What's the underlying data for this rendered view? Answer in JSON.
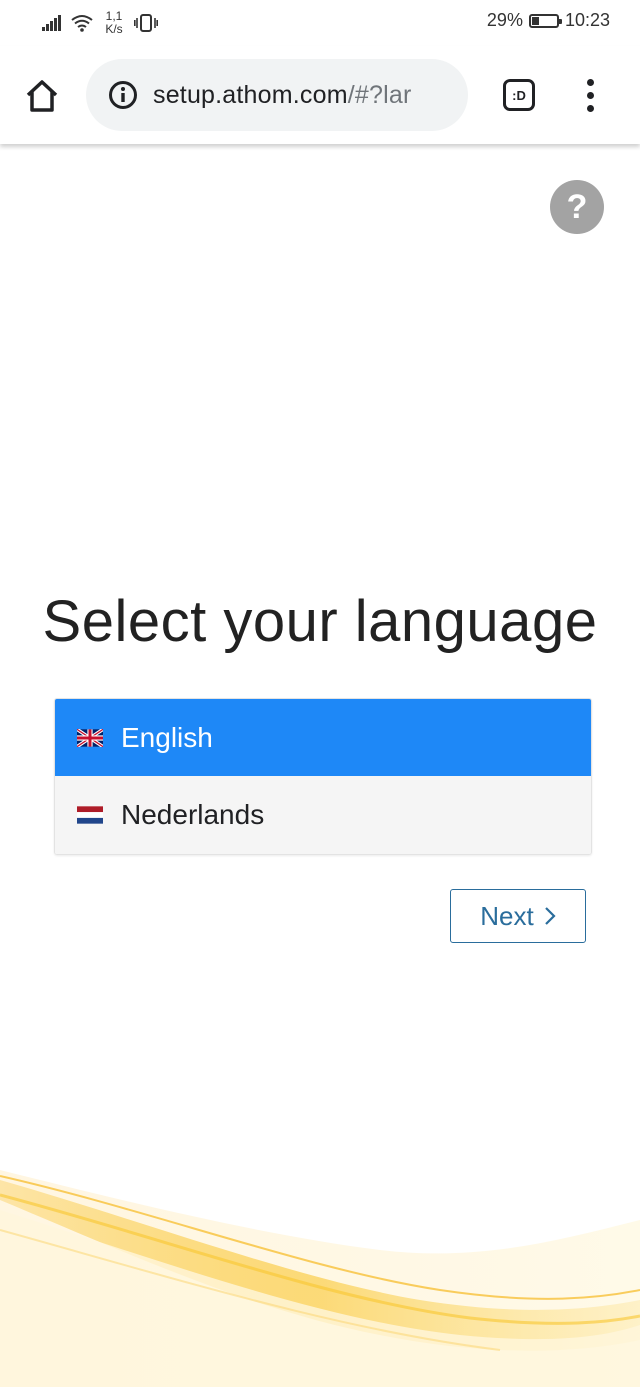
{
  "status_bar": {
    "speed_line1": "1,1",
    "speed_line2": "K/s",
    "battery_percent": "29%",
    "battery_level": 0.29,
    "time": "10:23"
  },
  "browser": {
    "url_host": "setup.athom.com",
    "url_path": "/#?lar",
    "tabs_label": ":D"
  },
  "page": {
    "help_label": "?",
    "title": "Select your language",
    "languages": [
      {
        "label": "English",
        "flag": "uk-flag-icon",
        "selected": true
      },
      {
        "label": "Nederlands",
        "flag": "netherlands-flag-icon",
        "selected": false
      }
    ],
    "next_label": "Next",
    "colors": {
      "selected_bg": "#1e88f7",
      "next_border": "#2a6d9c",
      "help_bg": "#a3a3a3",
      "wave": "#f9c62f"
    }
  }
}
